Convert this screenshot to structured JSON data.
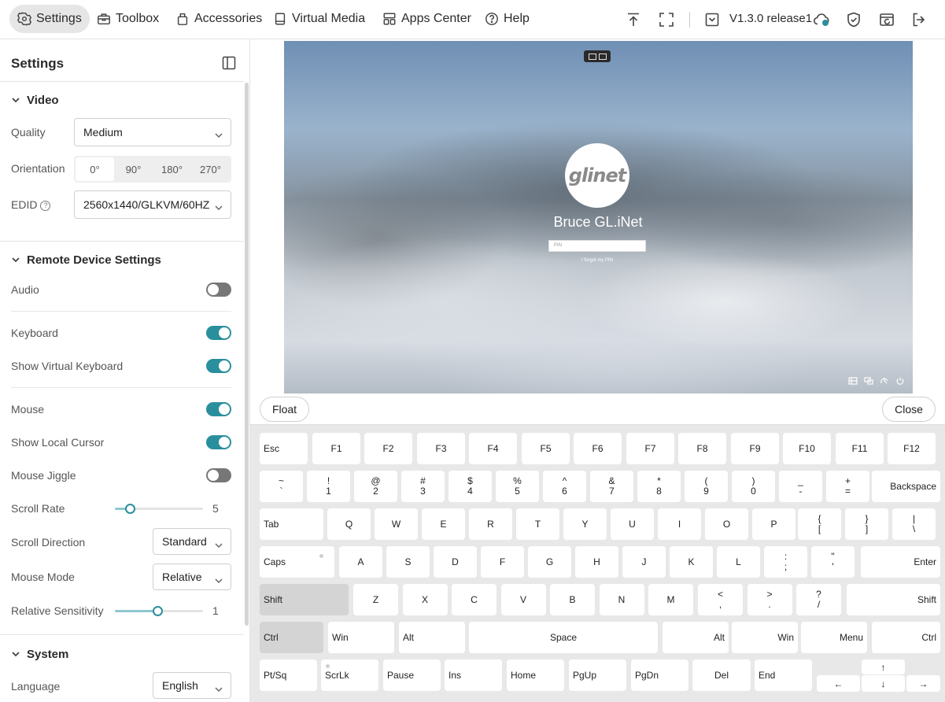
{
  "nav": {
    "items": [
      {
        "label": "Settings",
        "icon": "settings-icon"
      },
      {
        "label": "Toolbox",
        "icon": "toolbox-icon"
      },
      {
        "label": "Accessories",
        "icon": "accessories-icon"
      },
      {
        "label": "Virtual Media",
        "icon": "drive-icon"
      },
      {
        "label": "Apps Center",
        "icon": "apps-icon"
      },
      {
        "label": "Help",
        "icon": "help-icon"
      }
    ],
    "version": "V1.3.0 release1",
    "accent": "#2a8f9d"
  },
  "sidebar": {
    "title": "Settings",
    "video": {
      "heading": "Video",
      "quality_label": "Quality",
      "quality_value": "Medium",
      "orientation_label": "Orientation",
      "orientation_options": [
        "0°",
        "90°",
        "180°",
        "270°"
      ],
      "orientation_selected": "0°",
      "edid_label": "EDID",
      "edid_value": "2560x1440/GLKVM/60HZ"
    },
    "remote": {
      "heading": "Remote Device Settings",
      "audio_label": "Audio",
      "audio_on": false,
      "keyboard_label": "Keyboard",
      "keyboard_on": true,
      "show_vk_label": "Show Virtual Keyboard",
      "show_vk_on": true,
      "mouse_label": "Mouse",
      "mouse_on": true,
      "local_cursor_label": "Show Local Cursor",
      "local_cursor_on": true,
      "jiggle_label": "Mouse Jiggle",
      "jiggle_on": false,
      "scroll_rate_label": "Scroll Rate",
      "scroll_rate_value": "5",
      "scroll_rate_fraction": 0.17,
      "scroll_dir_label": "Scroll Direction",
      "scroll_dir_value": "Standard",
      "mouse_mode_label": "Mouse Mode",
      "mouse_mode_value": "Relative",
      "rel_sens_label": "Relative Sensitivity",
      "rel_sens_value": "1",
      "rel_sens_fraction": 0.48
    },
    "system": {
      "heading": "System",
      "language_label": "Language",
      "language_value": "English"
    }
  },
  "remote_screen": {
    "username": "Bruce GL.iNet",
    "pin_placeholder": "PIN",
    "forgot_link": "I forgot my PIN",
    "logo_text": "glinet"
  },
  "keyboard": {
    "float_label": "Float",
    "close_label": "Close",
    "fkeys": [
      "Esc",
      "F1",
      "F2",
      "F3",
      "F4",
      "F5",
      "F6",
      "F7",
      "F8",
      "F9",
      "F10",
      "F11",
      "F12"
    ],
    "row_num": [
      [
        "~",
        "`"
      ],
      [
        "!",
        "1"
      ],
      [
        "@",
        "2"
      ],
      [
        "#",
        "3"
      ],
      [
        "$",
        "4"
      ],
      [
        "%",
        "5"
      ],
      [
        "^",
        "6"
      ],
      [
        "&",
        "7"
      ],
      [
        "*",
        "8"
      ],
      [
        "(",
        "9"
      ],
      [
        ")",
        "0"
      ],
      [
        "_",
        "-"
      ],
      [
        "+",
        "="
      ]
    ],
    "backspace": "Backspace",
    "tab": "Tab",
    "row_q": [
      "Q",
      "W",
      "E",
      "R",
      "T",
      "Y",
      "U",
      "I",
      "O",
      "P"
    ],
    "row_q_sym": [
      [
        "{",
        "["
      ],
      [
        "}",
        "]"
      ],
      [
        "|",
        "\\"
      ]
    ],
    "caps": "Caps",
    "row_a": [
      "A",
      "S",
      "D",
      "F",
      "G",
      "H",
      "J",
      "K",
      "L"
    ],
    "row_a_sym": [
      [
        ":",
        ";"
      ],
      [
        "\"",
        "'"
      ]
    ],
    "enter": "Enter",
    "shift": "Shift",
    "row_z": [
      "Z",
      "X",
      "C",
      "V",
      "B",
      "N",
      "M"
    ],
    "row_z_sym": [
      [
        "<",
        ","
      ],
      [
        ">",
        "."
      ],
      [
        "?",
        "/"
      ]
    ],
    "bottom": {
      "ctrl": "Ctrl",
      "win": "Win",
      "alt": "Alt",
      "space": "Space",
      "menu": "Menu"
    },
    "nav_row": [
      "Pt/Sq",
      "ScrLk",
      "Pause",
      "Ins",
      "Home",
      "PgUp",
      "PgDn",
      "Del",
      "End"
    ],
    "arrows": {
      "up": "↑",
      "left": "←",
      "down": "↓",
      "right": "→"
    }
  }
}
